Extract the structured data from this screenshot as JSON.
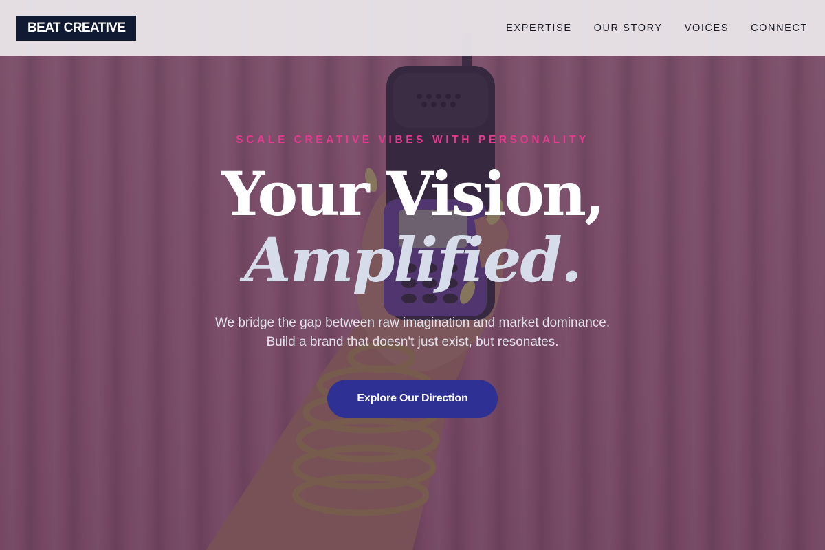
{
  "nav": {
    "logo": "BEAT CREATIVE",
    "links": [
      {
        "label": "EXPERTISE"
      },
      {
        "label": "OUR STORY"
      },
      {
        "label": "VOICES"
      },
      {
        "label": "CONNECT"
      }
    ]
  },
  "hero": {
    "eyebrow": "SCALE CREATIVE VIBES WITH PERSONALITY",
    "headline_line1": "Your Vision,",
    "headline_line2": "Amplified.",
    "subtext_line1": "We bridge the gap between raw imagination and market dominance.",
    "subtext_line2": "Build a brand that doesn't just exist, but resonates.",
    "cta_label": "Explore Our Direction"
  },
  "colors": {
    "nav_bg": "#e8e4e8",
    "logo_bg": "#111a33",
    "eyebrow": "#e23b8f",
    "cta_bg": "#2e3193",
    "overlay": "#3c2646"
  }
}
